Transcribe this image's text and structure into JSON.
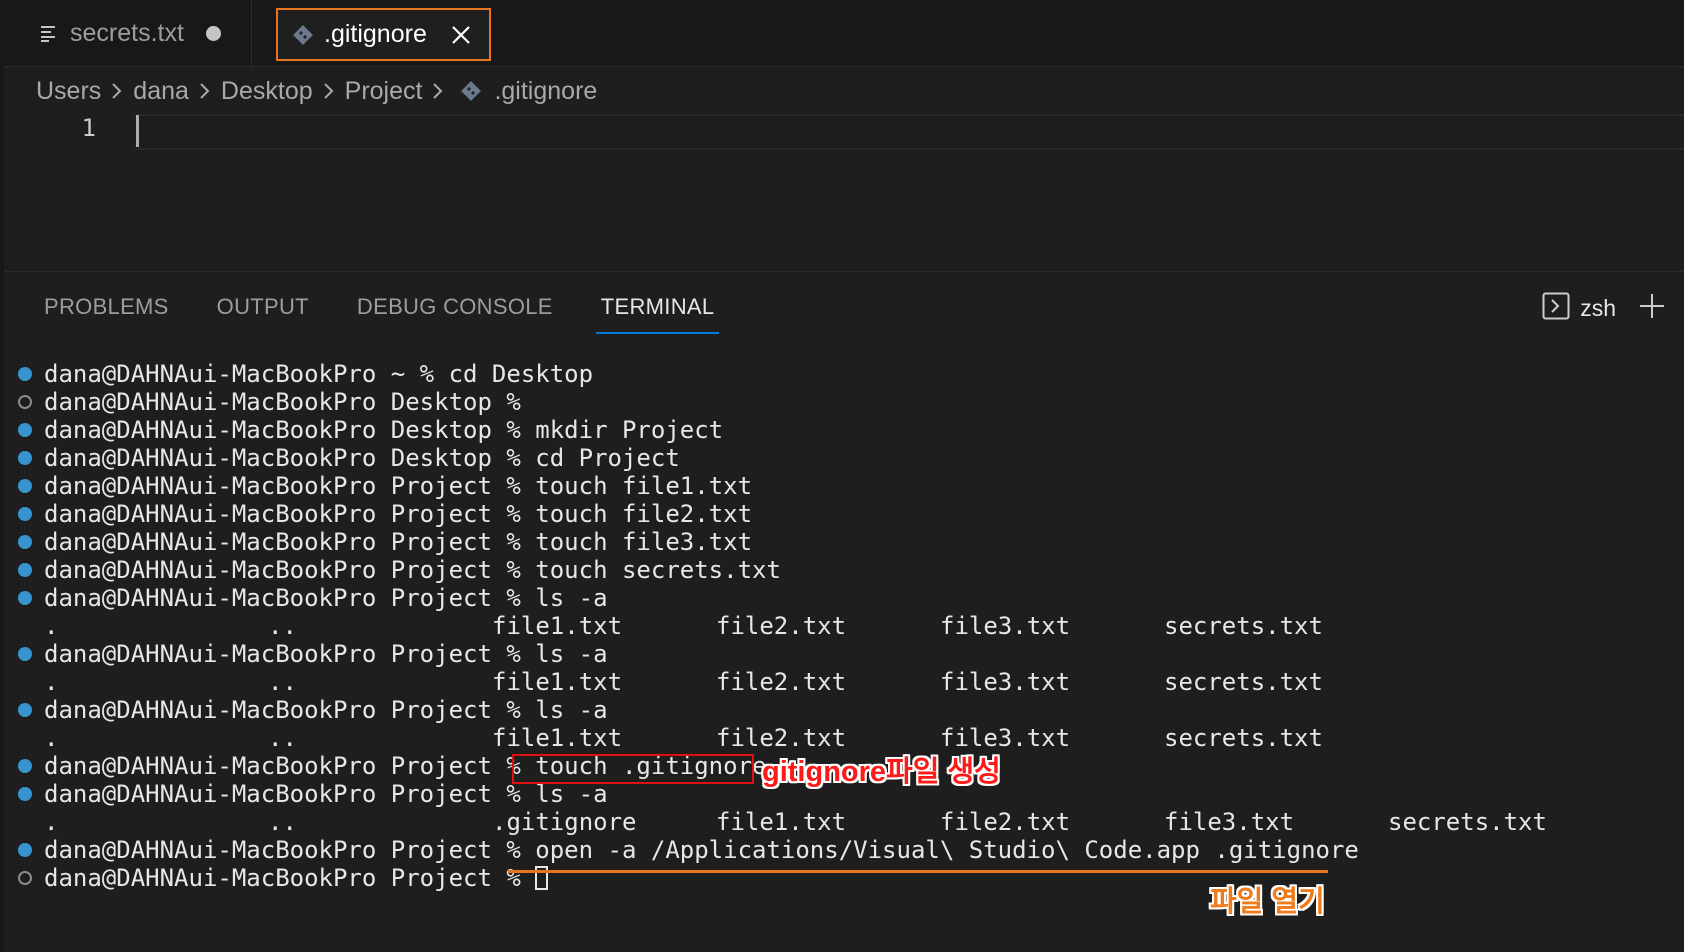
{
  "tabs": [
    {
      "label": "secrets.txt",
      "icon": "lines-icon",
      "modified": true
    },
    {
      "label": ".gitignore",
      "icon": "git-diamond-icon",
      "active": true
    }
  ],
  "breadcrumb": [
    "Users",
    "dana",
    "Desktop",
    "Project",
    ".gitignore"
  ],
  "editor": {
    "line_number": "1"
  },
  "panel": {
    "tabs": [
      "PROBLEMS",
      "OUTPUT",
      "DEBUG CONSOLE",
      "TERMINAL"
    ],
    "active_tab": "TERMINAL",
    "shell": "zsh"
  },
  "terminal": {
    "lines": [
      {
        "type": "cmd",
        "status": "filled",
        "text": "dana@DAHNAui-MacBookPro ~ % cd Desktop"
      },
      {
        "type": "cmd",
        "status": "hollow",
        "text": "dana@DAHNAui-MacBookPro Desktop %"
      },
      {
        "type": "cmd",
        "status": "filled",
        "text": "dana@DAHNAui-MacBookPro Desktop % mkdir Project"
      },
      {
        "type": "cmd",
        "status": "filled",
        "text": "dana@DAHNAui-MacBookPro Desktop % cd Project"
      },
      {
        "type": "cmd",
        "status": "filled",
        "text": "dana@DAHNAui-MacBookPro Project % touch file1.txt"
      },
      {
        "type": "cmd",
        "status": "filled",
        "text": "dana@DAHNAui-MacBookPro Project % touch file2.txt"
      },
      {
        "type": "cmd",
        "status": "filled",
        "text": "dana@DAHNAui-MacBookPro Project % touch file3.txt"
      },
      {
        "type": "cmd",
        "status": "filled",
        "text": "dana@DAHNAui-MacBookPro Project % touch secrets.txt"
      },
      {
        "type": "cmd",
        "status": "filled",
        "text": "dana@DAHNAui-MacBookPro Project % ls -a"
      },
      {
        "type": "out",
        "cols": [
          ".",
          "..",
          "file1.txt",
          "file2.txt",
          "file3.txt",
          "secrets.txt"
        ]
      },
      {
        "type": "cmd",
        "status": "filled",
        "text": "dana@DAHNAui-MacBookPro Project % ls -a"
      },
      {
        "type": "out",
        "cols": [
          ".",
          "..",
          "file1.txt",
          "file2.txt",
          "file3.txt",
          "secrets.txt"
        ]
      },
      {
        "type": "cmd",
        "status": "filled",
        "text": "dana@DAHNAui-MacBookPro Project % ls -a"
      },
      {
        "type": "out",
        "cols": [
          ".",
          "..",
          "file1.txt",
          "file2.txt",
          "file3.txt",
          "secrets.txt"
        ]
      },
      {
        "type": "cmd",
        "status": "filled",
        "text": "dana@DAHNAui-MacBookPro Project % touch .gitignore"
      },
      {
        "type": "cmd",
        "status": "filled",
        "text": "dana@DAHNAui-MacBookPro Project % ls -a"
      },
      {
        "type": "out",
        "cols": [
          ".",
          "..",
          ".gitignore",
          "file1.txt",
          "file2.txt",
          "file3.txt",
          "secrets.txt"
        ]
      },
      {
        "type": "cmd",
        "status": "filled",
        "text": "dana@DAHNAui-MacBookPro Project % open -a /Applications/Visual\\ Studio\\ Code.app .gitignore"
      },
      {
        "type": "cmd",
        "status": "hollow",
        "text": "dana@DAHNAui-MacBookPro Project % ",
        "cursor": true
      }
    ]
  },
  "annotations": {
    "create_label": "gitignore파일 생성",
    "open_label": "파일 열기",
    "colors": {
      "red": "#ff1a1a",
      "orange": "#f07b1b"
    }
  }
}
